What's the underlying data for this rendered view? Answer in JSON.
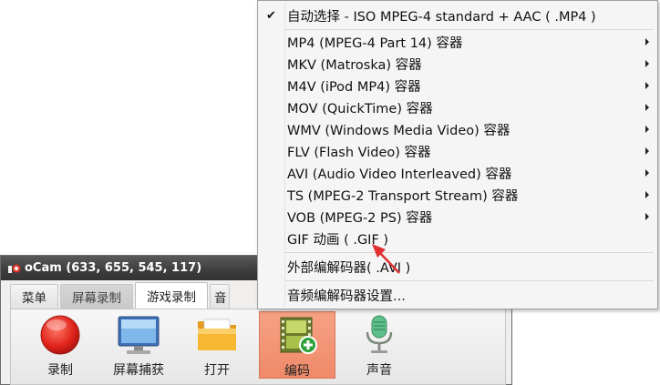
{
  "window": {
    "title": "oCam (633, 655, 545, 117)"
  },
  "tabs": [
    {
      "label": "菜单",
      "active": false
    },
    {
      "label": "屏幕录制",
      "active": false
    },
    {
      "label": "游戏录制",
      "active": true
    },
    {
      "label": "音",
      "active": false
    }
  ],
  "tools": [
    {
      "label": "录制",
      "icon": "record-icon"
    },
    {
      "label": "屏幕捕获",
      "icon": "monitor-icon"
    },
    {
      "label": "打开",
      "icon": "folder-icon"
    },
    {
      "label": "编码",
      "icon": "film-add-icon",
      "selected": true
    },
    {
      "label": "声音",
      "icon": "microphone-icon"
    }
  ],
  "menu": {
    "items": [
      {
        "label": "自动选择 - ISO MPEG-4 standard + AAC ( .MP4 )",
        "checked": true,
        "submenu": false
      },
      {
        "label": "MP4 (MPEG-4 Part 14) 容器",
        "checked": false,
        "submenu": true
      },
      {
        "label": "MKV (Matroska) 容器",
        "checked": false,
        "submenu": true
      },
      {
        "label": "M4V (iPod MP4) 容器",
        "checked": false,
        "submenu": true
      },
      {
        "label": "MOV (QuickTime) 容器",
        "checked": false,
        "submenu": true
      },
      {
        "label": "WMV (Windows Media Video) 容器",
        "checked": false,
        "submenu": true
      },
      {
        "label": "FLV (Flash Video) 容器",
        "checked": false,
        "submenu": true
      },
      {
        "label": "AVI (Audio Video Interleaved) 容器",
        "checked": false,
        "submenu": true
      },
      {
        "label": "TS (MPEG-2 Transport Stream) 容器",
        "checked": false,
        "submenu": true
      },
      {
        "label": "VOB (MPEG-2 PS) 容器",
        "checked": false,
        "submenu": true
      },
      {
        "label": "GIF 动画 ( .GIF )",
        "checked": false,
        "submenu": false
      },
      {
        "label": "外部编解码器( .AVI )",
        "checked": false,
        "submenu": false
      },
      {
        "label": "音频编解码器设置...",
        "checked": false,
        "submenu": false
      }
    ]
  },
  "colors": {
    "annotation_arrow": "#e03030",
    "selected_tool": "#ef8a6a"
  }
}
